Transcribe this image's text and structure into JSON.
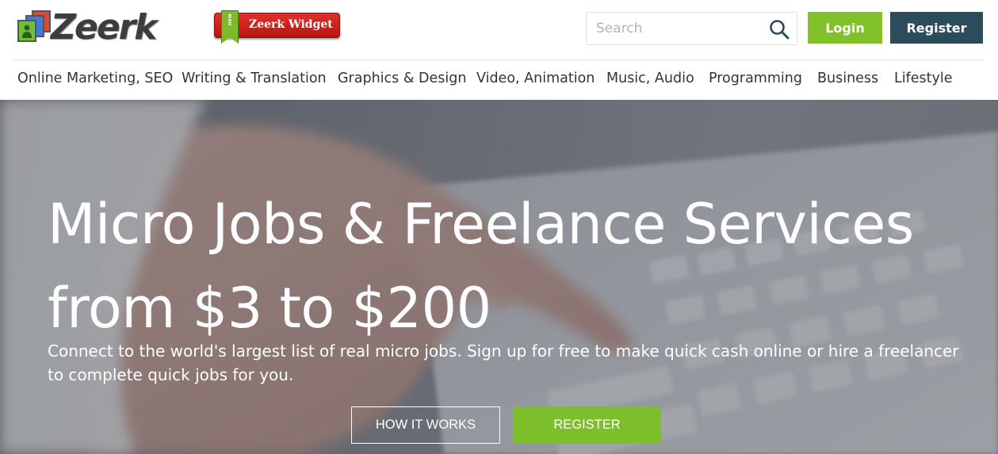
{
  "header": {
    "logo_text": "Zeerk",
    "widget": {
      "ribbon": "new",
      "label": "Zeerk Widget"
    },
    "search": {
      "placeholder": "Search",
      "value": ""
    },
    "login_label": "Login",
    "register_label": "Register"
  },
  "nav": {
    "items": [
      {
        "label": "Online Marketing, SEO"
      },
      {
        "label": "Writing & Translation"
      },
      {
        "label": "Graphics & Design"
      },
      {
        "label": "Video, Animation"
      },
      {
        "label": "Music, Audio"
      },
      {
        "label": "Programming"
      },
      {
        "label": "Business"
      },
      {
        "label": "Lifestyle"
      }
    ]
  },
  "hero": {
    "title_line1": "Micro Jobs & Freelance Services",
    "title_line2": "from $3 to $200",
    "subtitle": "Connect to the world's largest list of real micro jobs. Sign up for free to make quick cash online or hire a freelancer to complete quick jobs for you.",
    "how_it_works_label": "HOW IT WORKS",
    "register_label": "REGISTER"
  },
  "colors": {
    "login_green": "#83c12a",
    "register_dark": "#2b4d5b",
    "hero_register_green": "#7dbf2a",
    "widget_red": "#d0221c"
  },
  "icons": [
    "zeerk-logo-icon",
    "new-ribbon-icon",
    "search-icon"
  ]
}
